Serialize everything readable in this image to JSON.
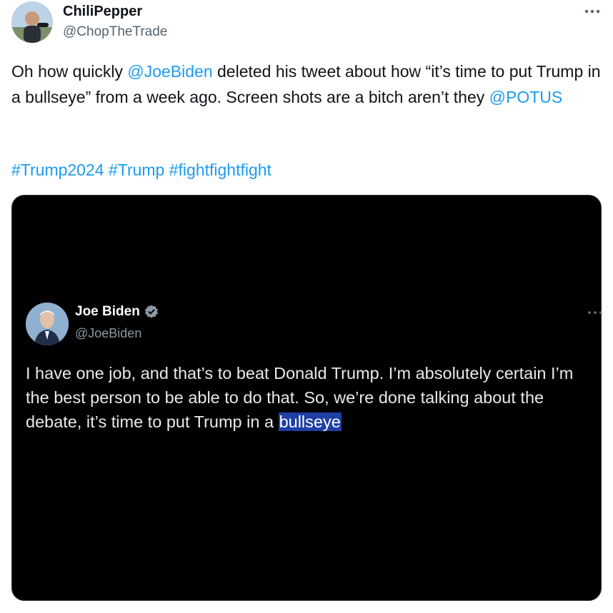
{
  "author": {
    "display_name": "ChiliPepper",
    "handle": "@ChopTheTrade",
    "avatar_icon": "profile-photo"
  },
  "more_icon": "more-horizontal-icon",
  "tweet": {
    "text_part1": "Oh how quickly ",
    "mention1": "@JoeBiden",
    "text_part2": " deleted his tweet about how “it’s time to put Trump in a bullseye” from a week ago.  Screen shots are a bitch aren’t they ",
    "mention2": "@POTUS",
    "hashtags": [
      "#Trump2024",
      "#Trump",
      "#fightfightfight"
    ]
  },
  "media": {
    "embedded_tweet": {
      "display_name": "Joe Biden",
      "handle": "@JoeBiden",
      "verified_icon": "verified-badge-icon",
      "text_before_highlight": "I have one job, and that’s to beat Donald Trump. I’m absolutely certain I’m the best person to be able to do that. So, we’re done talking about the debate, it’s time to put Trump in a ",
      "highlighted_text": "bullseye"
    }
  },
  "colors": {
    "link": "#1d9bf0",
    "text": "#0f1419",
    "secondary_text": "#536471",
    "media_bg": "#000000",
    "highlight": "#1e3fa3"
  }
}
